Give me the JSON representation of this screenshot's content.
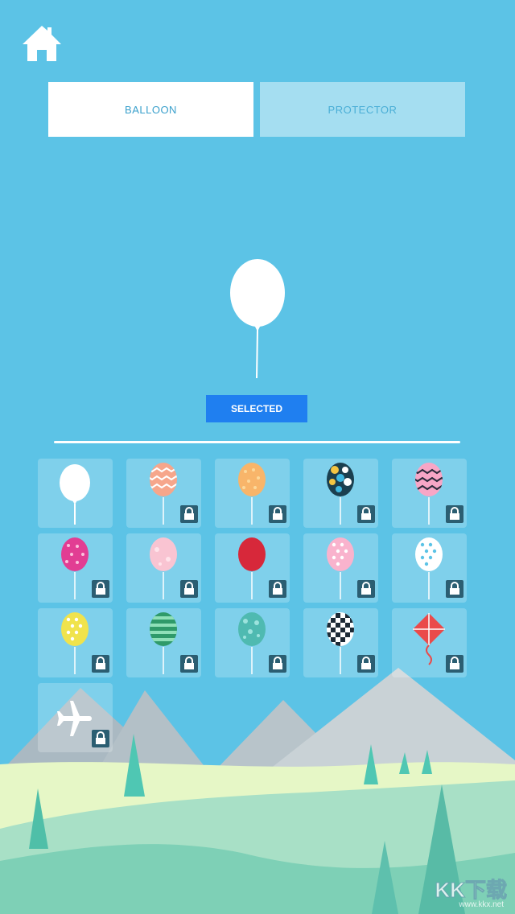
{
  "tabs": {
    "balloon_label": "BALLOON",
    "protector_label": "PROTECTOR"
  },
  "preview": {
    "button_label": "SELECTED"
  },
  "colors": {
    "sky": "#5cc3e6",
    "selected_button": "#1f7ff0",
    "lock": "#2b5e72"
  },
  "items": [
    {
      "name": "white-balloon",
      "locked": false
    },
    {
      "name": "pink-zigzag-balloon",
      "locked": true
    },
    {
      "name": "orange-dotted-balloon",
      "locked": true
    },
    {
      "name": "multicolor-circles-balloon",
      "locked": true
    },
    {
      "name": "pink-black-zigzag-balloon",
      "locked": true
    },
    {
      "name": "magenta-hearts-balloon",
      "locked": true
    },
    {
      "name": "light-pink-balloon",
      "locked": true
    },
    {
      "name": "red-balloon",
      "locked": true
    },
    {
      "name": "pink-polka-balloon",
      "locked": true
    },
    {
      "name": "white-polka-balloon",
      "locked": true
    },
    {
      "name": "yellow-polka-balloon",
      "locked": true
    },
    {
      "name": "green-striped-balloon",
      "locked": true
    },
    {
      "name": "teal-pattern-balloon",
      "locked": true
    },
    {
      "name": "checkered-balloon",
      "locked": true
    },
    {
      "name": "kite",
      "locked": true
    },
    {
      "name": "airplane",
      "locked": true
    }
  ],
  "watermark": {
    "title": "KK下载",
    "url": "www.kkx.net"
  }
}
